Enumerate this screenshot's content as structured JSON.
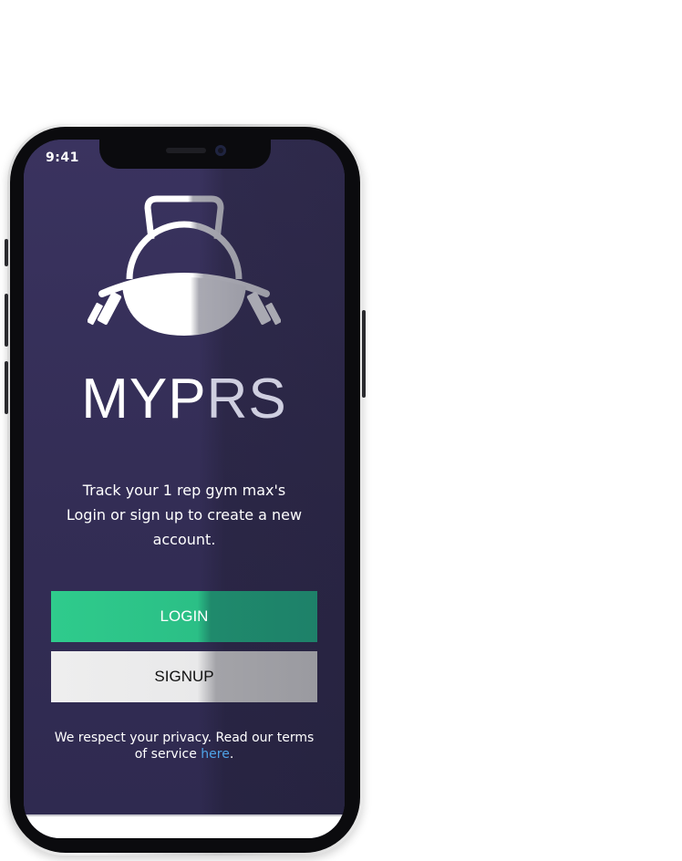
{
  "status_bar": {
    "time": "9:41"
  },
  "app": {
    "title_primary": "MYP",
    "title_secondary": "RS",
    "logo_icon": "kettlebell-barbell-icon"
  },
  "tagline": {
    "line1": "Track your 1 rep gym max's",
    "line2": "Login or sign up to create a new account."
  },
  "buttons": {
    "login_label": "LOGIN",
    "signup_label": "SIGNUP"
  },
  "privacy": {
    "text": "We respect your privacy. Read our terms of service ",
    "link_label": "here",
    "suffix": "."
  },
  "colors": {
    "background": "#35305a",
    "login_green": "#2fcb8c",
    "signup_gray": "#eeeeee",
    "link_blue": "#4fa3e8"
  }
}
